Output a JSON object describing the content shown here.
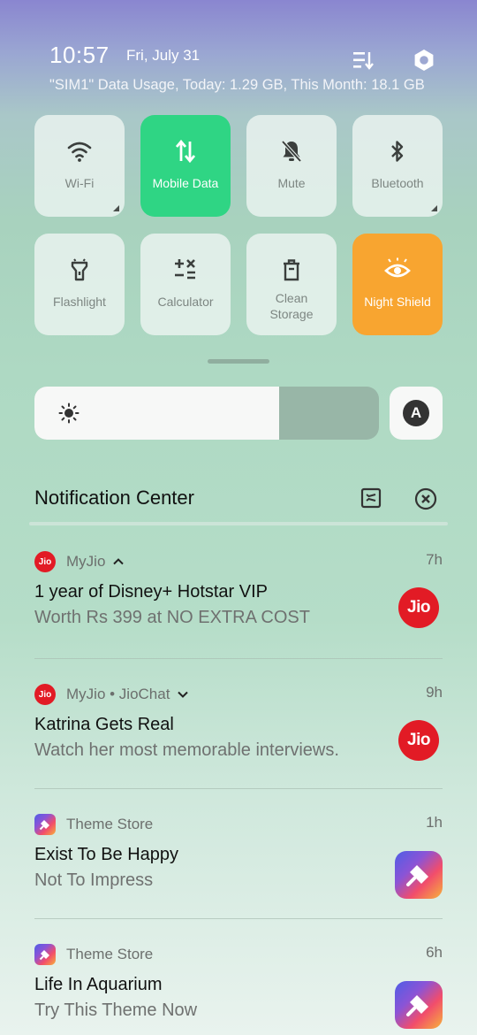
{
  "status": {
    "time": "10:57",
    "date": "Fri, July 31",
    "data_usage": "\"SIM1\" Data Usage, Today: 1.29 GB, This Month: 18.1 GB",
    "icons": [
      "edit-tiles-icon",
      "settings-icon"
    ]
  },
  "tiles": [
    {
      "label": "Wi-Fi",
      "icon": "wifi-icon",
      "active": false
    },
    {
      "label": "Mobile Data",
      "icon": "mobile-data-icon",
      "active": true,
      "color": "#2fd584"
    },
    {
      "label": "Mute",
      "icon": "mute-bell-icon",
      "active": false
    },
    {
      "label": "Bluetooth",
      "icon": "bluetooth-icon",
      "active": false
    },
    {
      "label": "Flashlight",
      "icon": "flashlight-icon",
      "active": false
    },
    {
      "label": "Calculator",
      "icon": "calculator-icon",
      "active": false
    },
    {
      "label": "Clean\nStorage",
      "icon": "trash-icon",
      "active": false
    },
    {
      "label": "Night Shield",
      "icon": "eye-icon",
      "active": true,
      "color": "#f8a530"
    }
  ],
  "brightness": {
    "level": 0.71,
    "icon": "sun-icon",
    "auto_label": "A"
  },
  "notification_center": {
    "title": "Notification Center",
    "icons": [
      "manage-notifications-icon",
      "clear-all-icon"
    ]
  },
  "notifications": [
    {
      "app": "MyJio",
      "time": "7h",
      "title": "1 year of Disney+ Hotstar VIP",
      "body": "Worth Rs 399 at NO EXTRA COST",
      "app_icon_text": "Jio",
      "thumb_text": "Jio",
      "expanded": true
    },
    {
      "app": "MyJio • JioChat",
      "time": "9h",
      "title": "Katrina Gets Real",
      "body": "Watch her most memorable interviews.",
      "app_icon_text": "Jio",
      "thumb_text": "Jio",
      "expanded": false
    },
    {
      "app": "Theme Store",
      "time": "1h",
      "title": "Exist To Be Happy",
      "body": "Not To Impress"
    },
    {
      "app": "Theme Store",
      "time": "6h",
      "title": "Life In Aquarium",
      "body": "Try This Theme Now"
    }
  ]
}
